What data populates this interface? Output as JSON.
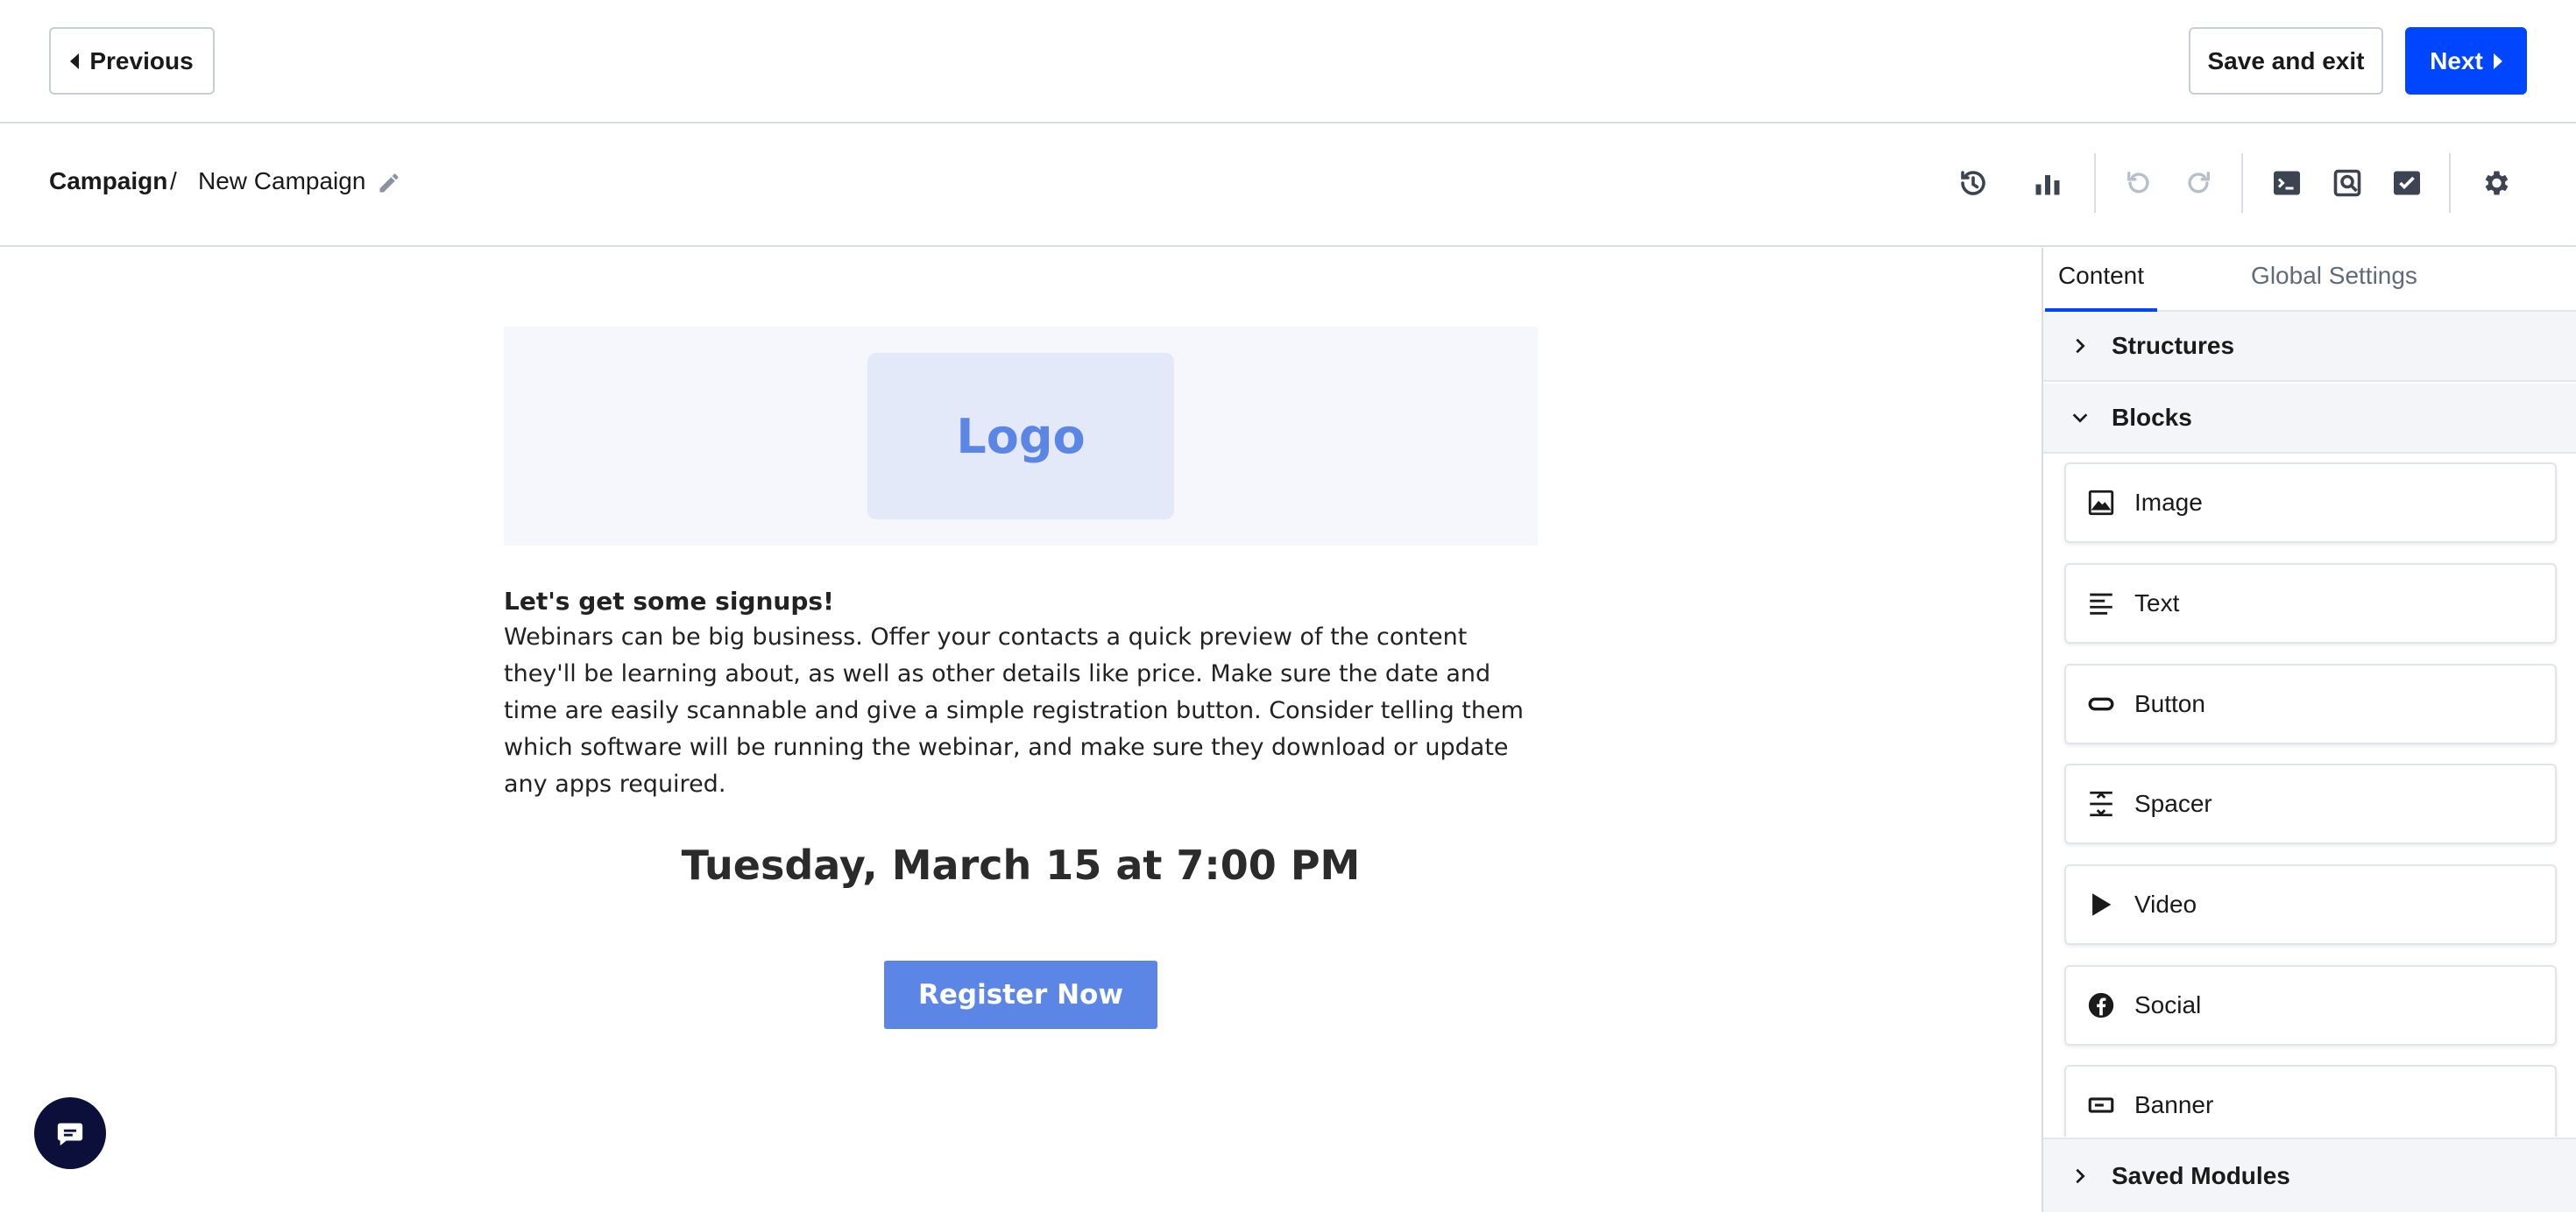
{
  "header": {
    "previous_label": "Previous",
    "save_exit_label": "Save and exit",
    "next_label": "Next",
    "primary_color": "#0046ff"
  },
  "breadcrumb": {
    "root": "Campaign",
    "separator": "/",
    "current": "New Campaign"
  },
  "toolbar_icons": [
    "history-icon",
    "bar-chart-icon",
    "undo-icon",
    "redo-icon",
    "code-icon",
    "preview-icon",
    "checklist-icon",
    "gear-icon"
  ],
  "email": {
    "logo_text": "Logo",
    "heading": "Let's get some signups!",
    "body": "Webinars can be big business. Offer your contacts a quick preview of the content they'll be learning about, as well as other details like price. Make sure the date and time are easily scannable and give a simple registration button. Consider telling them which software will be running the webinar, and make sure they download or update any apps required.",
    "date": "Tuesday, March 15 at 7:00 PM",
    "button_label": "Register Now",
    "accent_color": "#5b86e5"
  },
  "panel": {
    "tabs": [
      {
        "label": "Content",
        "active": true
      },
      {
        "label": "Global Settings",
        "active": false
      }
    ],
    "sections": {
      "structures": "Structures",
      "blocks": "Blocks",
      "saved_modules": "Saved Modules"
    },
    "blocks": [
      {
        "label": "Image",
        "icon": "image-icon"
      },
      {
        "label": "Text",
        "icon": "text-lines-icon"
      },
      {
        "label": "Button",
        "icon": "button-pill-icon"
      },
      {
        "label": "Spacer",
        "icon": "spacer-icon"
      },
      {
        "label": "Video",
        "icon": "play-icon"
      },
      {
        "label": "Social",
        "icon": "facebook-icon"
      },
      {
        "label": "Banner",
        "icon": "banner-icon"
      }
    ]
  },
  "chat": {
    "icon": "chat-icon"
  }
}
